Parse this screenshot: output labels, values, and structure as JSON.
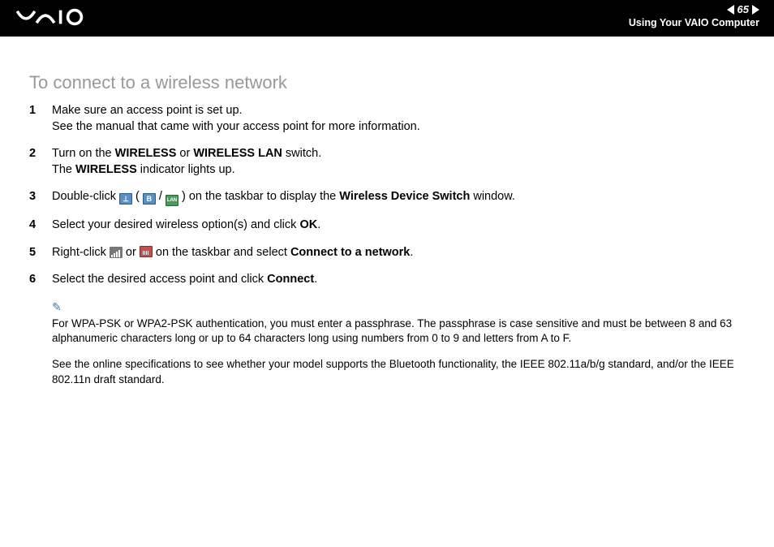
{
  "header": {
    "page_number": "65",
    "section": "Using Your VAIO Computer"
  },
  "title": "To connect to a wireless network",
  "steps": [
    {
      "num": "1",
      "lines": [
        "Make sure an access point is set up.",
        "See the manual that came with your access point for more information."
      ]
    },
    {
      "num": "2",
      "html": "Turn on the <b>WIRELESS</b> or <b>WIRELESS LAN</b> switch.<br>The <b>WIRELESS</b> indicator lights up."
    },
    {
      "num": "3",
      "html": "Double-click {icon_antenna} ( {icon_b} / {icon_lan} ) on the taskbar to display the <b>Wireless Device Switch</b> window."
    },
    {
      "num": "4",
      "html": "Select your desired wireless option(s) and click <b>OK</b>."
    },
    {
      "num": "5",
      "html": "Right-click {icon_signal} or {icon_red} on the taskbar and select <b>Connect to a network</b>."
    },
    {
      "num": "6",
      "html": "Select the desired access point and click <b>Connect</b>."
    }
  ],
  "note": {
    "p1": "For WPA-PSK or WPA2-PSK authentication, you must enter a passphrase. The passphrase is case sensitive and must be between 8 and 63 alphanumeric characters long or up to 64 characters long using numbers from 0 to 9 and letters from A to F.",
    "p2": "See the online specifications to see whether your model supports the Bluetooth functionality, the IEEE 802.11a/b/g standard, and/or the IEEE 802.11n draft standard."
  }
}
